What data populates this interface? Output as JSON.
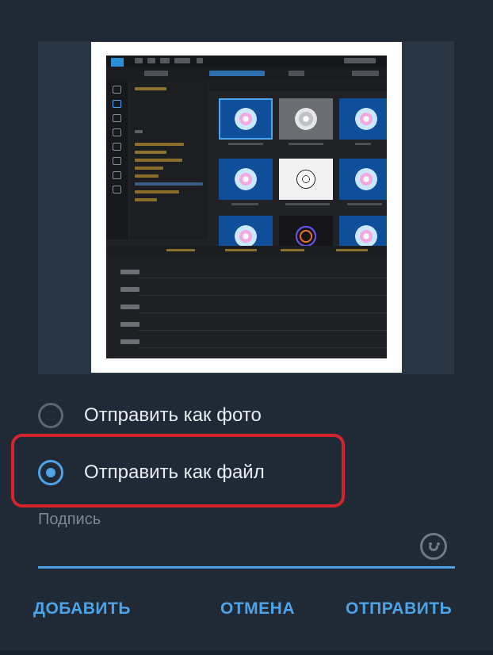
{
  "options": {
    "send_as_photo": "Отправить как фото",
    "send_as_file": "Отправить как файл",
    "selected": "send_as_file"
  },
  "caption": {
    "placeholder": "Подпись"
  },
  "actions": {
    "add": "ДОБАВИТЬ",
    "cancel": "ОТМЕНА",
    "send": "ОТПРАВИТЬ"
  },
  "colors": {
    "accent": "#4ea3e6",
    "highlight": "#d1252b",
    "background": "#1f2a36"
  }
}
